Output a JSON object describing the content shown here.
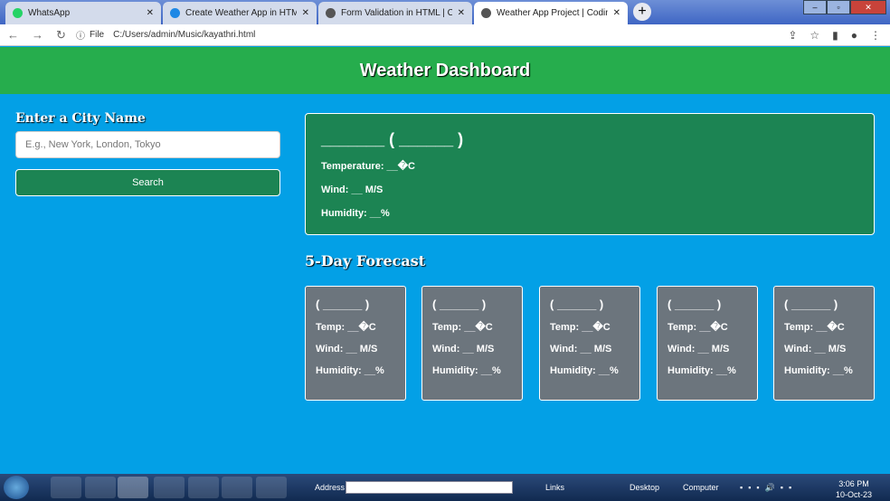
{
  "browser": {
    "tabs": [
      {
        "title": "WhatsApp"
      },
      {
        "title": "Create Weather App in HTML Bo"
      },
      {
        "title": "Form Validation in HTML | Codin"
      },
      {
        "title": "Weather App Project | CodingNe"
      }
    ],
    "file_label": "File",
    "url": "C:/Users/admin/Music/kayathri.html"
  },
  "header": {
    "title": "Weather Dashboard"
  },
  "search": {
    "label": "Enter a City Name",
    "placeholder": "E.g., New York, London, Tokyo",
    "button": "Search"
  },
  "current": {
    "title": "_______ ( ______ )",
    "temperature": "Temperature: __�C",
    "wind": "Wind: __ M/S",
    "humidity": "Humidity: __%"
  },
  "forecast": {
    "title": "5-Day Forecast",
    "cards": [
      {
        "date": "( ______ )",
        "temp": "Temp: __�C",
        "wind": "Wind: __ M/S",
        "humidity": "Humidity: __%"
      },
      {
        "date": "( ______ )",
        "temp": "Temp: __�C",
        "wind": "Wind: __ M/S",
        "humidity": "Humidity: __%"
      },
      {
        "date": "( ______ )",
        "temp": "Temp: __�C",
        "wind": "Wind: __ M/S",
        "humidity": "Humidity: __%"
      },
      {
        "date": "( ______ )",
        "temp": "Temp: __�C",
        "wind": "Wind: __ M/S",
        "humidity": "Humidity: __%"
      },
      {
        "date": "( ______ )",
        "temp": "Temp: __�C",
        "wind": "Wind: __ M/S",
        "humidity": "Humidity: __%"
      }
    ]
  },
  "taskbar": {
    "address": "Address",
    "links": "Links",
    "desktop": "Desktop",
    "computer": "Computer",
    "time": "3:06 PM",
    "date": "10-Oct-23"
  },
  "colors": {
    "header": "#26ad4d",
    "background": "#03a0e6",
    "current_card": "#1c8453",
    "forecast_card": "#6c757d"
  }
}
